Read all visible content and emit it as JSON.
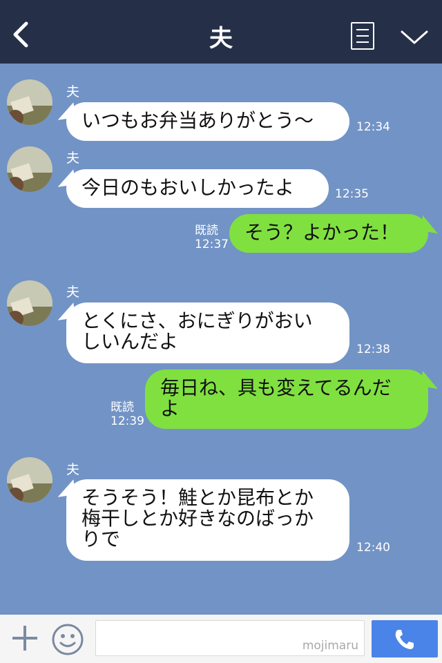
{
  "header": {
    "title": "夫"
  },
  "messages": [
    {
      "sender": "夫",
      "text": "いつもお弁当ありがとう〜",
      "time": "12:34"
    },
    {
      "sender": "夫",
      "text": "今日のもおいしかったよ",
      "time": "12:35"
    },
    {
      "text": "そう？よかった！",
      "read": "既読",
      "time": "12:37"
    },
    {
      "sender": "夫",
      "line1": "とくにさ、おにぎりがおい",
      "line2": "しいんだよ",
      "time": "12:38"
    },
    {
      "line1": "毎日ね、具も変えてるんだ",
      "line2": "よ",
      "read": "既読",
      "time": "12:39"
    },
    {
      "sender": "夫",
      "line1": "そうそう！鮭とか昆布とか",
      "line2": "梅干しとか好きなのばっか",
      "line3": "りで",
      "time": "12:40"
    }
  ],
  "footer": {
    "watermark": "mojimaru"
  },
  "colors": {
    "header": "#253048",
    "background": "#7293c5",
    "incoming": "#ffffff",
    "outgoing": "#80e040",
    "send": "#4b84e8"
  }
}
